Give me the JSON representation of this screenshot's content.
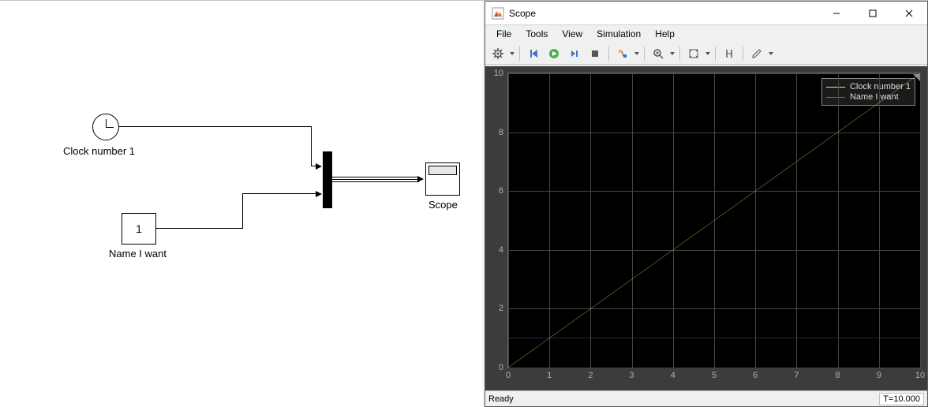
{
  "simulink": {
    "blocks": {
      "clock": {
        "label": "Clock number 1"
      },
      "constant": {
        "label": "Name I want",
        "value": "1"
      },
      "scope": {
        "label": "Scope"
      }
    }
  },
  "scope_window": {
    "title": "Scope",
    "menu": {
      "file": "File",
      "tools": "Tools",
      "view": "View",
      "simulation": "Simulation",
      "help": "Help"
    },
    "toolbar_icons": {
      "config": "gear-icon",
      "restart": "restart-icon",
      "run": "run-icon",
      "step": "step-icon",
      "stop": "stop-icon",
      "highlight": "highlight-icon",
      "zoom": "zoom-icon",
      "autoscale": "autoscale-icon",
      "measure": "measure-icon",
      "annotate": "annotate-icon"
    },
    "legend": {
      "series1": "Clock number 1",
      "series2": "Name I want"
    },
    "status": {
      "ready": "Ready",
      "time": "T=10.000"
    }
  },
  "chart_data": {
    "type": "line",
    "title": "",
    "xlabel": "",
    "ylabel": "",
    "xlim": [
      0,
      10
    ],
    "ylim": [
      0,
      10
    ],
    "x_ticks": [
      0,
      1,
      2,
      3,
      4,
      5,
      6,
      7,
      8,
      9,
      10
    ],
    "y_ticks": [
      0,
      2,
      4,
      6,
      8,
      10
    ],
    "x": [
      0,
      1,
      2,
      3,
      4,
      5,
      6,
      7,
      8,
      9,
      10
    ],
    "series": [
      {
        "name": "Clock number 1",
        "color": "#e8e85a",
        "values": [
          0,
          1,
          2,
          3,
          4,
          5,
          6,
          7,
          8,
          9,
          10
        ]
      },
      {
        "name": "Name I want",
        "color": "#4a6fa5",
        "values": [
          1,
          1,
          1,
          1,
          1,
          1,
          1,
          1,
          1,
          1,
          1
        ]
      }
    ]
  }
}
